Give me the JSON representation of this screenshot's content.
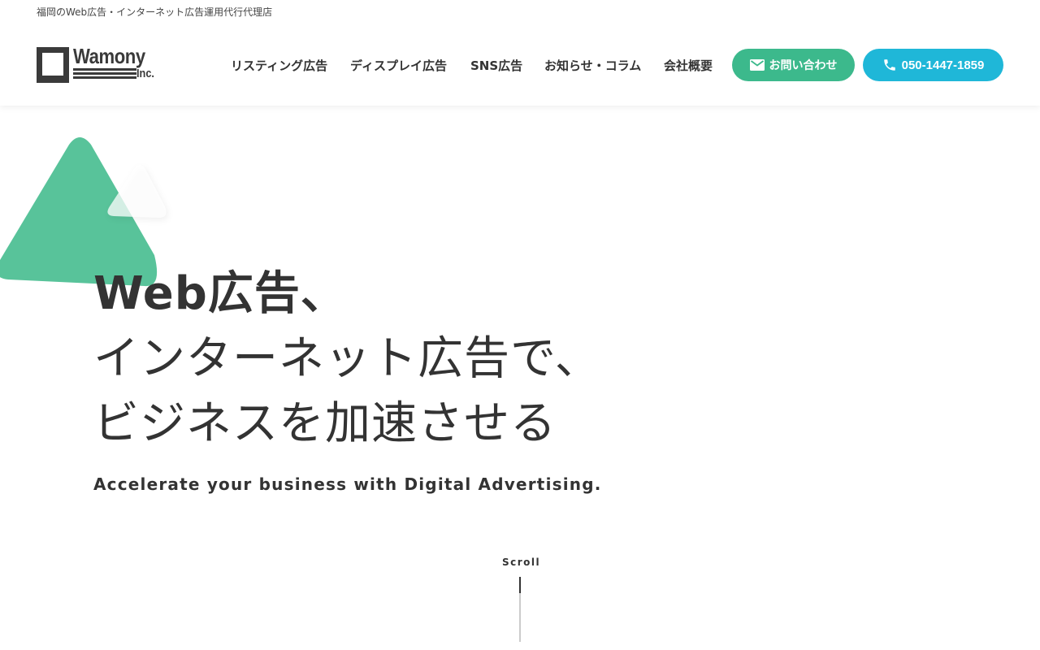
{
  "header": {
    "tagline": "福岡のWeb広告・インターネット広告運用代行代理店",
    "logo": {
      "name": "Wamony",
      "suffix": "Inc."
    },
    "nav": [
      {
        "label": "リスティング広告"
      },
      {
        "label": "ディスプレイ広告"
      },
      {
        "label": "SNS広告"
      },
      {
        "label": "お知らせ・コラム"
      },
      {
        "label": "会社概要"
      }
    ],
    "contact_button": {
      "label": "お問い合わせ",
      "icon": "mail-icon",
      "color": "#3cb98c"
    },
    "phone_button": {
      "label": "050-1447-1859",
      "icon": "phone-icon",
      "color": "#1fb7d8"
    }
  },
  "hero": {
    "title_lines": [
      "Web広告、",
      "インターネット広告で、",
      "ビジネスを加速させる"
    ],
    "subtitle": "Accelerate your business with Digital Advertising.",
    "accent_color": "#58c39a"
  },
  "scroll_indicator": {
    "label": "Scroll"
  }
}
